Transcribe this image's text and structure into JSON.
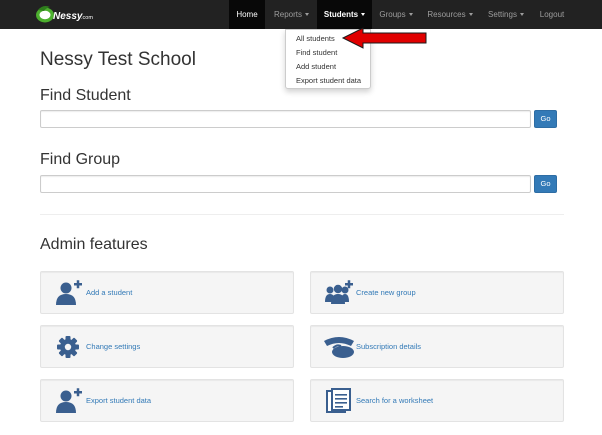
{
  "brand": {
    "logo_text": "Nessy",
    "logo_suffix": ".com"
  },
  "nav": {
    "items": [
      {
        "label": "Home",
        "state": "active",
        "has_caret": false
      },
      {
        "label": "Reports",
        "state": "normal",
        "has_caret": true
      },
      {
        "label": "Students",
        "state": "open",
        "has_caret": true
      },
      {
        "label": "Groups",
        "state": "normal",
        "has_caret": true
      },
      {
        "label": "Resources",
        "state": "normal",
        "has_caret": true
      },
      {
        "label": "Settings",
        "state": "normal",
        "has_caret": true
      },
      {
        "label": "Logout",
        "state": "normal",
        "has_caret": false
      }
    ]
  },
  "dropdown": {
    "items": [
      "All students",
      "Find student",
      "Add student",
      "Export student data"
    ]
  },
  "page": {
    "school_name": "Nessy Test School",
    "find_student": {
      "heading": "Find Student",
      "value": "",
      "button": "Go"
    },
    "find_group": {
      "heading": "Find Group",
      "value": "",
      "button": "Go"
    },
    "admin_heading": "Admin features"
  },
  "features": [
    {
      "label": "Add a student",
      "icon": "add-user-icon"
    },
    {
      "label": "Create new group",
      "icon": "add-group-icon"
    },
    {
      "label": "Change settings",
      "icon": "gear-icon"
    },
    {
      "label": "Subscription details",
      "icon": "telephone-icon"
    },
    {
      "label": "Export student data",
      "icon": "export-user-icon"
    },
    {
      "label": "Search for a worksheet",
      "icon": "worksheet-icon"
    }
  ],
  "colors": {
    "navbar": "#222222",
    "link": "#337ab7",
    "arrow": "#e00000",
    "icon": "#3a5f8f",
    "logo_green": "#4caf2e"
  }
}
